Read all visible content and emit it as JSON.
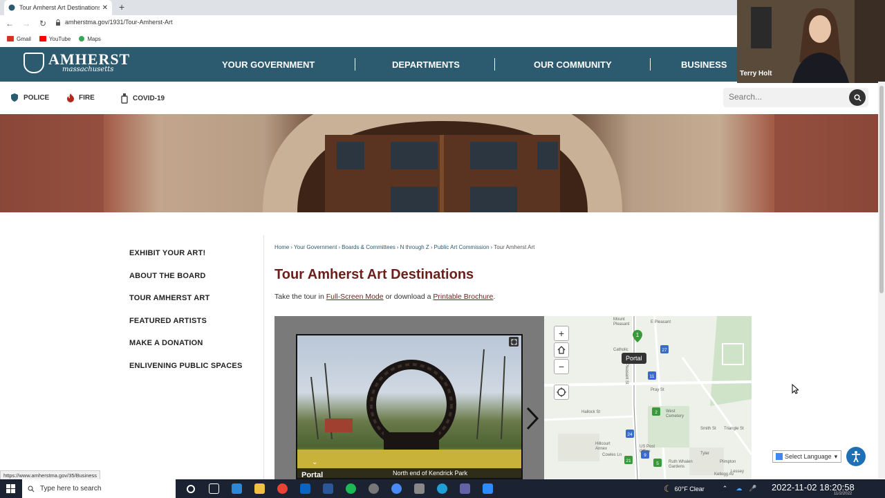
{
  "browser": {
    "tab_title": "Tour Amherst Art Destinations | A",
    "url": "amherstma.gov/1931/Tour-Amherst-Art",
    "bookmarks": [
      "Gmail",
      "YouTube",
      "Maps"
    ]
  },
  "header": {
    "logo_name": "AMHERST",
    "logo_sub": "massachusetts",
    "nav": [
      "YOUR GOVERNMENT",
      "DEPARTMENTS",
      "OUR COMMUNITY",
      "BUSINESS"
    ]
  },
  "quicklinks": [
    "POLICE",
    "FIRE",
    "COVID-19"
  ],
  "search": {
    "placeholder": "Search..."
  },
  "sidemenu": [
    "EXHIBIT YOUR ART!",
    "ABOUT THE BOARD",
    "TOUR AMHERST ART",
    "FEATURED ARTISTS",
    "MAKE A DONATION",
    "ENLIVENING PUBLIC SPACES"
  ],
  "breadcrumb": [
    "Home",
    "Your Government",
    "Boards & Committees",
    "N through Z",
    "Public Art Commission",
    "Tour Amherst Art"
  ],
  "page": {
    "title": "Tour Amherst Art Destinations",
    "intro_prefix": "Take the tour in ",
    "intro_link1": "Full-Screen Mode",
    "intro_mid": " or download a ",
    "intro_link2": "Printable Brochure",
    "intro_suffix": "."
  },
  "tour": {
    "caption_name": "Portal",
    "caption_location": "North end of Kendrick Park"
  },
  "map": {
    "tooltip": "Portal",
    "markers": [
      "1",
      "27",
      "11",
      "2",
      "24",
      "21",
      "9",
      "5"
    ],
    "labels": [
      "Mount Pleasant",
      "E Pleasant",
      "Catholic",
      "Pray St",
      "N Pleasant St",
      "Hallock St",
      "West Cemetery",
      "Hillcourt Annex",
      "Cowles Ln",
      "US Post Office",
      "Ruth Whalen Gardens",
      "Tyler",
      "Plimpton",
      "Kellogg Av",
      "Triangle St",
      "Smith St",
      "Lessey"
    ]
  },
  "video": {
    "name": "Terry Holt"
  },
  "status_link": "https://www.amherstma.gov/35/Business",
  "language": "Select Language",
  "taskbar": {
    "search_placeholder": "Type here to search",
    "weather": "60°F  Clear",
    "clock": "2022-11-02  18:20:58",
    "date_small": "11/2/2022"
  },
  "colors": {
    "header_bg": "#2c5a6e",
    "title_color": "#6b1f1b",
    "accessibility": "#1d6fb6"
  }
}
